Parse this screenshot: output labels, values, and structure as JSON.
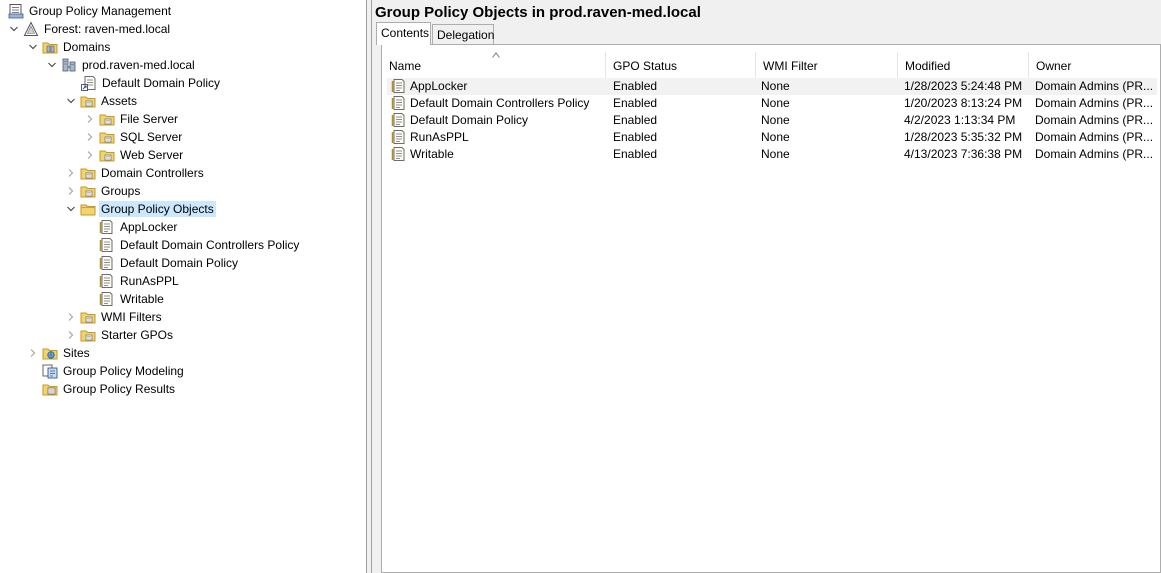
{
  "tree": {
    "root_label": "Group Policy Management",
    "forest_label": "Forest: raven-med.local",
    "domains_label": "Domains",
    "domain_label": "prod.raven-med.local",
    "default_domain_policy_link": "Default Domain Policy",
    "assets_label": "Assets",
    "file_server_label": "File Server",
    "sql_server_label": "SQL Server",
    "web_server_label": "Web Server",
    "domain_controllers_label": "Domain Controllers",
    "groups_label": "Groups",
    "gpo_container_label": "Group Policy Objects",
    "gpo_children": [
      "AppLocker",
      "Default Domain Controllers Policy",
      "Default Domain Policy",
      "RunAsPPL",
      "Writable"
    ],
    "wmi_filters_label": "WMI Filters",
    "starter_gpos_label": "Starter GPOs",
    "sites_label": "Sites",
    "modeling_label": "Group Policy Modeling",
    "results_label": "Group Policy Results"
  },
  "right": {
    "title": "Group Policy Objects in prod.raven-med.local",
    "tabs": [
      {
        "label": "Contents",
        "active": true
      },
      {
        "label": "Delegation",
        "active": false
      }
    ],
    "columns": [
      "Name",
      "GPO Status",
      "WMI Filter",
      "Modified",
      "Owner"
    ],
    "rows": [
      {
        "name": "AppLocker",
        "status": "Enabled",
        "wmi": "None",
        "modified": "1/28/2023 5:24:48 PM",
        "owner": "Domain Admins (PR..."
      },
      {
        "name": "Default Domain Controllers Policy",
        "status": "Enabled",
        "wmi": "None",
        "modified": "1/20/2023 8:13:24 PM",
        "owner": "Domain Admins (PR..."
      },
      {
        "name": "Default Domain Policy",
        "status": "Enabled",
        "wmi": "None",
        "modified": "4/2/2023 1:13:34 PM",
        "owner": "Domain Admins (PR..."
      },
      {
        "name": "RunAsPPL",
        "status": "Enabled",
        "wmi": "None",
        "modified": "1/28/2023 5:35:32 PM",
        "owner": "Domain Admins (PR..."
      },
      {
        "name": "Writable",
        "status": "Enabled",
        "wmi": "None",
        "modified": "4/13/2023 7:36:38 PM",
        "owner": "Domain Admins (PR..."
      }
    ]
  },
  "colors": {
    "selection": "#cce8ff",
    "folder": "#e8c04a",
    "row_highlight": "#f2f2f2"
  }
}
